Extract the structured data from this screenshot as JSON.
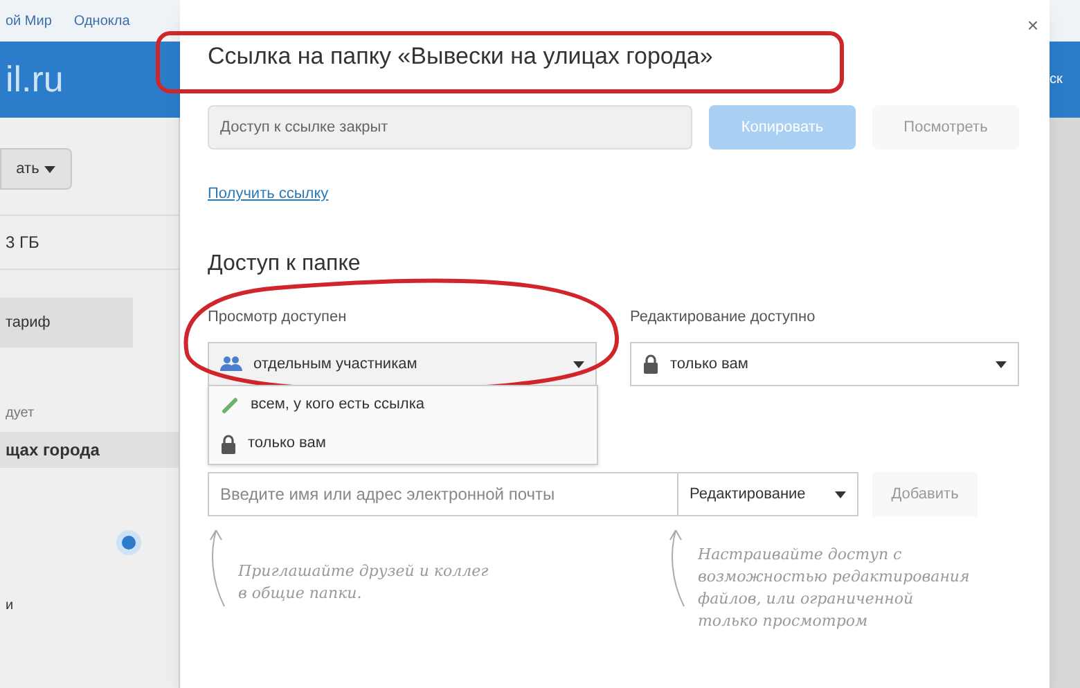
{
  "background": {
    "top_links": [
      "ой Мир",
      "Однокла"
    ],
    "logo": "il.ru",
    "create_button": "ать",
    "storage": "3 ГБ",
    "tariff_button": "тариф",
    "section_label": "дует",
    "folder_item": {
      "label": "щах города",
      "selected": true
    },
    "bottom_label": "и",
    "right_text": "ск"
  },
  "dialog": {
    "title": "Ссылка на папку «Вывески на улицах города»",
    "link_field": {
      "value": "Доступ к ссылке закрыт",
      "disabled": true
    },
    "copy_button": {
      "label": "Копировать",
      "disabled": true
    },
    "view_button": {
      "label": "Посмотреть",
      "disabled": true
    },
    "get_link": "Получить ссылку",
    "access_heading": "Доступ к папке",
    "view_access": {
      "label": "Просмотр доступен",
      "value": "отдельным участникам",
      "kind": "group",
      "expanded": true,
      "options": [
        {
          "label": "всем, у кого есть ссылка",
          "kind": "link"
        },
        {
          "label": "только вам",
          "kind": "lock"
        }
      ]
    },
    "edit_access": {
      "label": "Редактирование доступно",
      "value": "только вам",
      "kind": "lock",
      "expanded": false
    },
    "invite": {
      "placeholder": "Введите имя или адрес электронной почты",
      "role": "Редактирование",
      "add_button": {
        "label": "Добавить",
        "disabled": true
      }
    },
    "hints": [
      "Приглашайте друзей и коллег в общие папки.",
      "Настраивайте доступ с возможностью редактирования файлов, или ограниченной только просмотром"
    ],
    "close": "×"
  }
}
